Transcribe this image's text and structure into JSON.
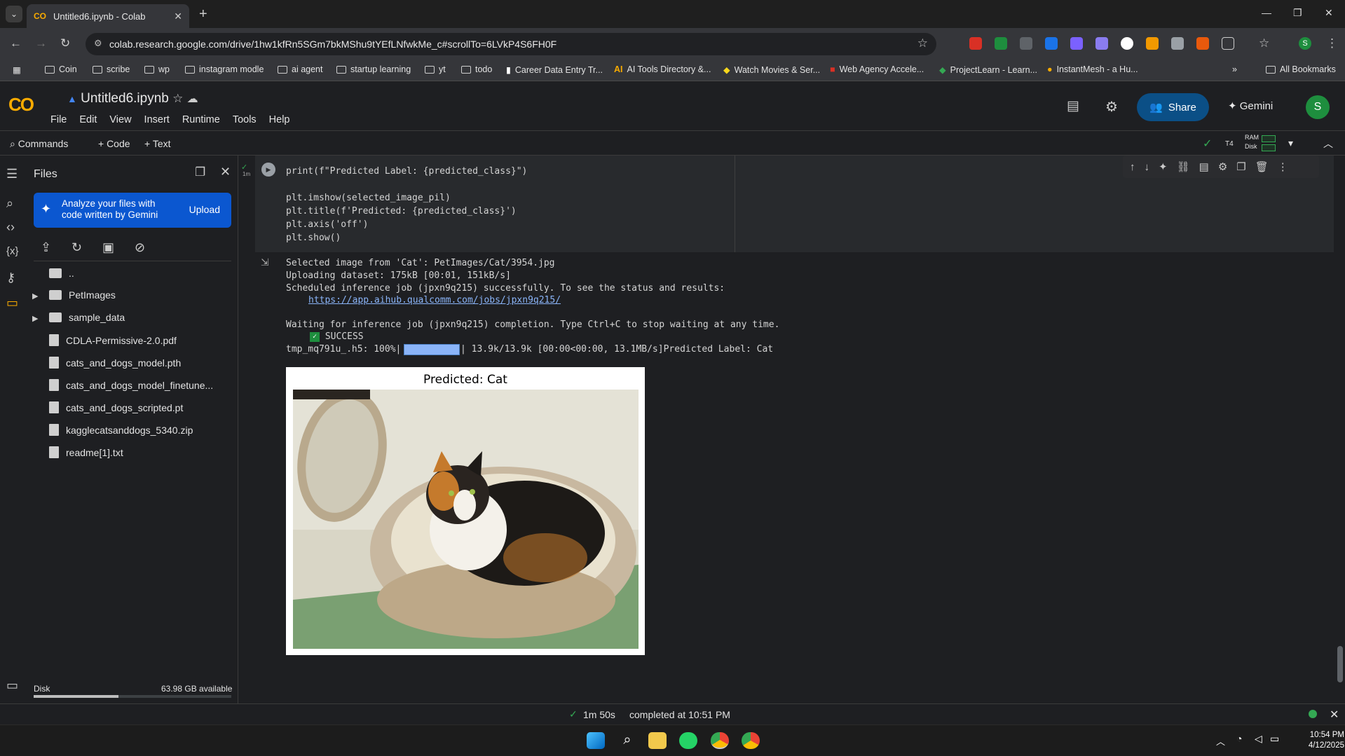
{
  "browser": {
    "tab_title": "Untitled6.ipynb - Colab",
    "tab_logo": "CO",
    "url": "colab.research.google.com/drive/1hw1kfRn5SGm7bkMShu9tYEfLNfwkMe_c#scrollTo=6LVkP4S6FH0F",
    "bookmarks": [
      "Coin",
      "scribe",
      "wp",
      "instagram modle",
      "ai agent",
      "startup learning",
      "yt",
      "todo",
      "Career Data Entry Tr...",
      "AI Tools Directory &...",
      "Watch Movies & Ser...",
      "Web Agency Accele...",
      "ProjectLearn - Learn...",
      "InstantMesh - a Hu..."
    ],
    "all_bookmarks": "All Bookmarks",
    "profile_initial": "S"
  },
  "colab": {
    "notebook_title": "Untitled6.ipynb",
    "menu": [
      "File",
      "Edit",
      "View",
      "Insert",
      "Runtime",
      "Tools",
      "Help"
    ],
    "share_label": "Share",
    "gemini_label": "Gemini",
    "avatar_initial": "S",
    "commands_label": "Commands",
    "add_code_label": "+ Code",
    "add_text_label": "+ Text",
    "runtime_type": "T4",
    "ram_label": "RAM",
    "disk_label_small": "Disk"
  },
  "files": {
    "title": "Files",
    "gemini_banner": "Analyze your files with code written by Gemini",
    "upload_label": "Upload",
    "parent_dir": "..",
    "items": [
      {
        "name": "PetImages",
        "type": "folder"
      },
      {
        "name": "sample_data",
        "type": "folder"
      },
      {
        "name": "CDLA-Permissive-2.0.pdf",
        "type": "file"
      },
      {
        "name": "cats_and_dogs_model.pth",
        "type": "file"
      },
      {
        "name": "cats_and_dogs_model_finetune...",
        "type": "file"
      },
      {
        "name": "cats_and_dogs_scripted.pt",
        "type": "file"
      },
      {
        "name": "kagglecatsanddogs_5340.zip",
        "type": "file"
      },
      {
        "name": "readme[1].txt",
        "type": "file"
      }
    ],
    "disk_label": "Disk",
    "disk_available": "63.98 GB available",
    "disk_used_fraction": 0.43
  },
  "cell": {
    "exec_time": "1m",
    "code_lines": [
      "print(f\"Predicted Label: {predicted_class}\")",
      "",
      "plt.imshow(selected_image_pil)",
      "plt.title(f'Predicted: {predicted_class}')",
      "plt.axis('off')",
      "plt.show()"
    ],
    "output_lines": [
      "Selected image from 'Cat': PetImages/Cat/3954.jpg",
      "Uploading dataset: 175kB [00:01, 151kB/s]",
      "Scheduled inference job (jpxn9q215) successfully. To see the status and results:",
      "Waiting for inference job (jpxn9q215) completion. Type Ctrl+C to stop waiting at any time.",
      "SUCCESS"
    ],
    "job_link": "https://app.aihub.qualcomm.com/jobs/jpxn9q215/",
    "progress_prefix": "tmp_mq791u_.h5: 100%|",
    "progress_suffix": "| 13.9k/13.9k [00:00<00:00, 13.1MB/s]Predicted Label: Cat",
    "progress_fraction": 1.0,
    "plot_title": "Predicted: Cat"
  },
  "status": {
    "duration": "1m 50s",
    "completed": "completed at 10:51 PM"
  },
  "taskbar": {
    "time": "10:54 PM",
    "date": "4/12/2025"
  }
}
